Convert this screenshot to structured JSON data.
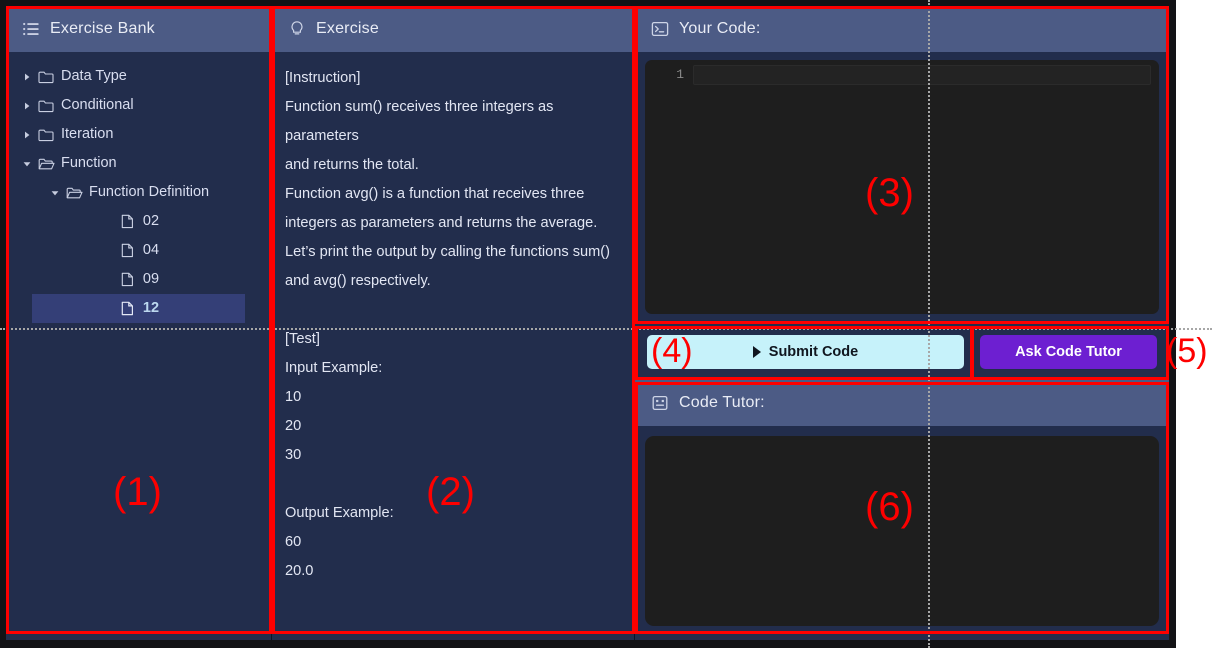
{
  "app": {
    "background_color": "#16182a",
    "panel_color": "#222d4c",
    "header_color": "#4c5b85",
    "accent_submit": "#c6f2fa",
    "accent_tutor": "#6d1fd1",
    "annotation_color": "#fe0000"
  },
  "sidebar": {
    "title": "Exercise Bank",
    "icon": "list-icon",
    "items": [
      {
        "label": "Data Type",
        "icon": "folder-closed-icon",
        "chevron": "chevron-right-icon",
        "depth": 0,
        "selected": false
      },
      {
        "label": "Conditional",
        "icon": "folder-closed-icon",
        "chevron": "chevron-right-icon",
        "depth": 0,
        "selected": false
      },
      {
        "label": "Iteration",
        "icon": "folder-closed-icon",
        "chevron": "chevron-right-icon",
        "depth": 0,
        "selected": false
      },
      {
        "label": "Function",
        "icon": "folder-open-icon",
        "chevron": "chevron-down-icon",
        "depth": 0,
        "selected": false
      },
      {
        "label": "Function Definition",
        "icon": "folder-open-icon",
        "chevron": "chevron-down-icon",
        "depth": 1,
        "selected": false
      },
      {
        "label": "02",
        "icon": "file-icon",
        "chevron": "",
        "depth": 2,
        "selected": false
      },
      {
        "label": "04",
        "icon": "file-icon",
        "chevron": "",
        "depth": 2,
        "selected": false
      },
      {
        "label": "09",
        "icon": "file-icon",
        "chevron": "",
        "depth": 2,
        "selected": false
      },
      {
        "label": "12",
        "icon": "file-icon",
        "chevron": "",
        "depth": 2,
        "selected": true
      }
    ]
  },
  "exercise": {
    "title": "Exercise",
    "icon": "lightbulb-icon",
    "lines": [
      "[Instruction]",
      "Function sum() receives three integers as parameters",
      "and returns the total.",
      "Function avg() is a function that receives three",
      "integers as parameters and returns the average.",
      "Let’s print the output by calling the functions sum()",
      "and avg() respectively.",
      "",
      "[Test]",
      "Input Example:",
      "10",
      "20",
      "30",
      "",
      "Output Example:",
      "60",
      "20.0"
    ]
  },
  "code_panel": {
    "title": "Your Code:",
    "icon": "terminal-icon",
    "line_numbers": [
      "1"
    ],
    "code": "",
    "placeholder": ""
  },
  "buttons": {
    "submit": {
      "label": "Submit Code",
      "icon": "play-icon"
    },
    "ask_tutor": {
      "label": "Ask Code Tutor"
    }
  },
  "tutor_panel": {
    "title": "Code Tutor:",
    "icon": "robot-face-icon",
    "content": ""
  },
  "annotations": [
    {
      "id": "1",
      "label": "(1)"
    },
    {
      "id": "2",
      "label": "(2)"
    },
    {
      "id": "3",
      "label": "(3)"
    },
    {
      "id": "4",
      "label": "(4)"
    },
    {
      "id": "5",
      "label": "(5)"
    },
    {
      "id": "6",
      "label": "(6)"
    }
  ]
}
